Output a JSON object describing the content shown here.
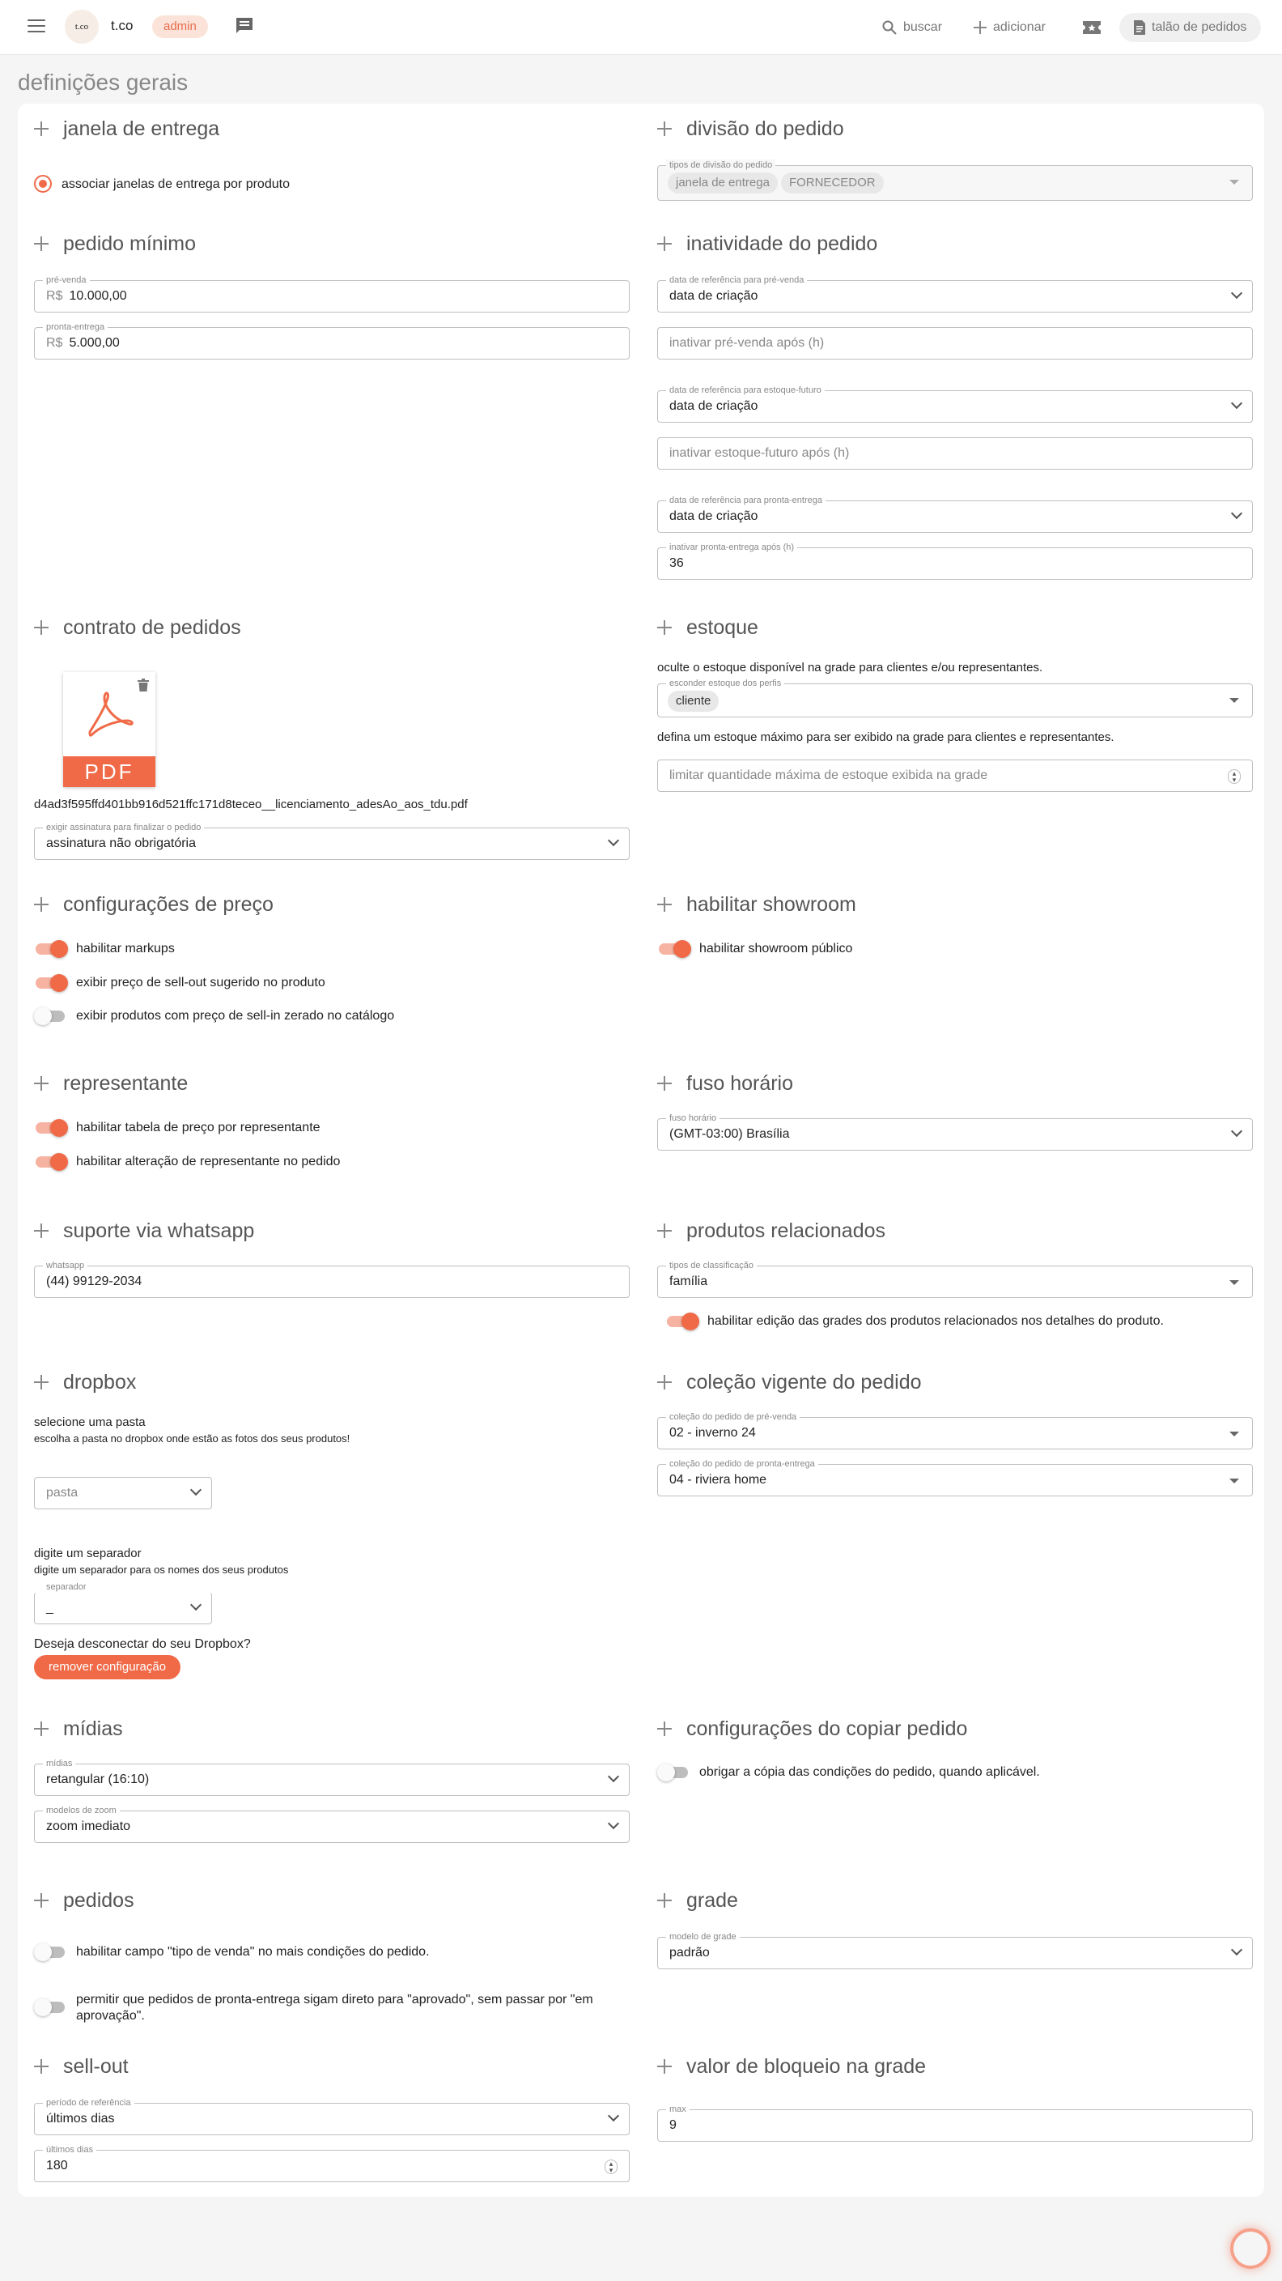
{
  "topbar": {
    "brand": "t.co",
    "logo_text": "t.co",
    "admin": "admin",
    "search": "buscar",
    "add": "adicionar",
    "talao": "talão de pedidos"
  },
  "page_title": "definições gerais",
  "janela": {
    "title": "janela de entrega",
    "radio_label": "associar janelas de entrega por produto"
  },
  "divisao": {
    "title": "divisão do pedido",
    "field_label": "tipos de divisão do pedido",
    "chips": [
      "janela de entrega",
      "FORNECEDOR"
    ]
  },
  "pedido_minimo": {
    "title": "pedido mínimo",
    "prevenda_label": "pré-venda",
    "prefix": "R$",
    "prevenda_value": "10.000,00",
    "pronta_label": "pronta-entrega",
    "pronta_value": "5.000,00"
  },
  "inatividade": {
    "title": "inatividade do pedido",
    "ref_prevenda_label": "data de referência para pré-venda",
    "ref_prevenda_value": "data de criação",
    "inativar_prevenda_ph": "inativar pré-venda após (h)",
    "ref_estoque_label": "data de referência para estoque-futuro",
    "ref_estoque_value": "data de criação",
    "inativar_estoque_ph": "inativar estoque-futuro após (h)",
    "ref_pronta_label": "data de referência para pronta-entrega",
    "ref_pronta_value": "data de criação",
    "inativar_pronta_label": "inativar pronta-entrega após (h)",
    "inativar_pronta_value": "36"
  },
  "contrato": {
    "title": "contrato de pedidos",
    "pdf_label": "PDF",
    "filename": "d4ad3f595ffd401bb916d521ffc171d8teceo__licenciamento_adesAo_aos_tdu.pdf",
    "assinatura_label": "exigir assinatura para finalizar o pedido",
    "assinatura_value": "assinatura não obrigatória"
  },
  "estoque": {
    "title": "estoque",
    "desc1": "oculte o estoque disponível na grade para clientes e/ou representantes.",
    "esconder_label": "esconder estoque dos perfis",
    "chip": "cliente",
    "desc2": "defina um estoque máximo para ser exibido na grade para clientes e representantes.",
    "limitar_ph": "limitar quantidade máxima de estoque exibida na grade"
  },
  "preco": {
    "title": "configurações de preço",
    "items": [
      "habilitar markups",
      "exibir preço de sell-out sugerido no produto",
      "exibir produtos com preço de sell-in zerado no catálogo"
    ]
  },
  "showroom": {
    "title": "habilitar showroom",
    "item": "habilitar showroom público"
  },
  "representante": {
    "title": "representante",
    "items": [
      "habilitar tabela de preço por representante",
      "habilitar alteração de representante no pedido"
    ]
  },
  "fuso": {
    "title": "fuso horário",
    "label": "fuso horário",
    "value": "(GMT-03:00) Brasília"
  },
  "whatsapp": {
    "title": "suporte via whatsapp",
    "label": "whatsapp",
    "value": "(44) 99129-2034"
  },
  "relacionados": {
    "title": "produtos relacionados",
    "label": "tipos de classificação",
    "value": "família",
    "toggle": "habilitar edição das grades dos produtos relacionados nos detalhes do produto."
  },
  "dropbox": {
    "title": "dropbox",
    "pasta_title": "selecione uma pasta",
    "pasta_desc": "escolha a pasta no dropbox onde estão as fotos dos seus produtos!",
    "pasta_ph": "pasta",
    "sep_title": "digite um separador",
    "sep_desc": "digite um separador para os nomes dos seus produtos",
    "sep_label": "separador",
    "sep_value": "_",
    "disconnect": "Deseja desconectar do seu Dropbox?",
    "remove": "remover configuração"
  },
  "colecao": {
    "title": "coleção vigente do pedido",
    "prevenda_label": "coleção do pedido de pré-venda",
    "prevenda_value": "02 - inverno 24",
    "pronta_label": "coleção do pedido de pronta-entrega",
    "pronta_value": "04 - riviera home"
  },
  "midias": {
    "title": "mídias",
    "midias_label": "mídias",
    "midias_value": "retangular (16:10)",
    "zoom_label": "modelos de zoom",
    "zoom_value": "zoom imediato"
  },
  "copiar": {
    "title": "configurações do copiar pedido",
    "item": "obrigar a cópia das condições do pedido, quando aplicável."
  },
  "pedidos": {
    "title": "pedidos",
    "item1": "habilitar campo \"tipo de venda\" no mais condições do pedido.",
    "item2": "permitir que pedidos de pronta-entrega sigam direto para \"aprovado\", sem passar por \"em aprovação\"."
  },
  "grade": {
    "title": "grade",
    "label": "modelo de grade",
    "value": "padrão"
  },
  "sellout": {
    "title": "sell-out",
    "periodo_label": "período de referência",
    "periodo_value": "últimos dias",
    "dias_label": "últimos dias",
    "dias_value": "180"
  },
  "bloqueio": {
    "title": "valor de bloqueio na grade",
    "label": "max",
    "value": "9"
  }
}
